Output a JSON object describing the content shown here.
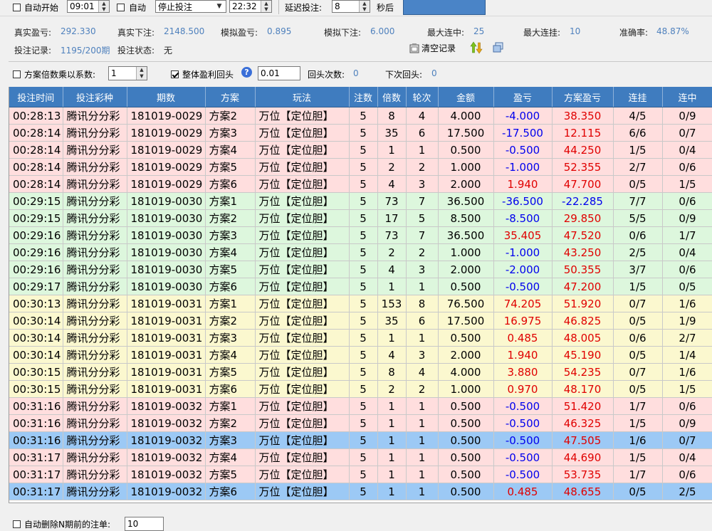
{
  "topbar": {
    "auto_start_label": "自动开始",
    "auto_start_time": "09:01",
    "auto_label": "自动",
    "stop_select": "停止投注",
    "stop_time": "22:32",
    "delay_label": "延迟投注:",
    "delay_value": "8",
    "delay_unit": "秒后"
  },
  "stats": {
    "real_profit_label": "真实盈亏:",
    "real_profit": "292.330",
    "real_bet_label": "真实下注:",
    "real_bet": "2148.500",
    "sim_profit_label": "模拟盈亏:",
    "sim_profit": "0.895",
    "sim_bet_label": "模拟下注:",
    "sim_bet": "6.000",
    "max_streak_hit_label": "最大连中:",
    "max_streak_hit": "25",
    "max_streak_miss_label": "最大连挂:",
    "max_streak_miss": "10",
    "accuracy_label": "准确率:",
    "accuracy": "48.87%",
    "record_label": "投注记录:",
    "record_value": "1195/200期",
    "status_label": "投注状态:",
    "status_value": "无",
    "clear_label": "清空记录"
  },
  "options": {
    "multiplier_label": "方案倍数乘以系数:",
    "multiplier_value": "1",
    "rollback_label": "整体盈利回头",
    "rollback_value": "0.01",
    "rollback_count_label": "回头次数:",
    "rollback_count": "0",
    "next_rollback_label": "下次回头:",
    "next_rollback": "0"
  },
  "table": {
    "headers": [
      "投注时间",
      "投注彩种",
      "期数",
      "方案",
      "玩法",
      "注数",
      "倍数",
      "轮次",
      "金额",
      "盈亏",
      "方案盈亏",
      "连挂",
      "连中"
    ],
    "rows": [
      {
        "time": "00:28:13",
        "lottery": "腾讯分分彩",
        "period": "181019-0029",
        "plan": "方案2",
        "play": "万位【定位胆】",
        "count": "5",
        "mult": "8",
        "round": "4",
        "amount": "4.000",
        "profit": "-4.000",
        "plan_profit": "38.350",
        "miss": "4/5",
        "hit": "0/9",
        "color": "pink",
        "profit_sign": "neg",
        "plan_sign": "pos"
      },
      {
        "time": "00:28:14",
        "lottery": "腾讯分分彩",
        "period": "181019-0029",
        "plan": "方案3",
        "play": "万位【定位胆】",
        "count": "5",
        "mult": "35",
        "round": "6",
        "amount": "17.500",
        "profit": "-17.500",
        "plan_profit": "12.115",
        "miss": "6/6",
        "hit": "0/7",
        "color": "pink",
        "profit_sign": "neg",
        "plan_sign": "pos"
      },
      {
        "time": "00:28:14",
        "lottery": "腾讯分分彩",
        "period": "181019-0029",
        "plan": "方案4",
        "play": "万位【定位胆】",
        "count": "5",
        "mult": "1",
        "round": "1",
        "amount": "0.500",
        "profit": "-0.500",
        "plan_profit": "44.250",
        "miss": "1/5",
        "hit": "0/4",
        "color": "pink",
        "profit_sign": "neg",
        "plan_sign": "pos"
      },
      {
        "time": "00:28:14",
        "lottery": "腾讯分分彩",
        "period": "181019-0029",
        "plan": "方案5",
        "play": "万位【定位胆】",
        "count": "5",
        "mult": "2",
        "round": "2",
        "amount": "1.000",
        "profit": "-1.000",
        "plan_profit": "52.355",
        "miss": "2/7",
        "hit": "0/6",
        "color": "pink",
        "profit_sign": "neg",
        "plan_sign": "pos"
      },
      {
        "time": "00:28:14",
        "lottery": "腾讯分分彩",
        "period": "181019-0029",
        "plan": "方案6",
        "play": "万位【定位胆】",
        "count": "5",
        "mult": "4",
        "round": "3",
        "amount": "2.000",
        "profit": "1.940",
        "plan_profit": "47.700",
        "miss": "0/5",
        "hit": "1/5",
        "color": "pink",
        "profit_sign": "pos",
        "plan_sign": "pos"
      },
      {
        "time": "00:29:15",
        "lottery": "腾讯分分彩",
        "period": "181019-0030",
        "plan": "方案1",
        "play": "万位【定位胆】",
        "count": "5",
        "mult": "73",
        "round": "7",
        "amount": "36.500",
        "profit": "-36.500",
        "plan_profit": "-22.285",
        "miss": "7/7",
        "hit": "0/6",
        "color": "green",
        "profit_sign": "neg",
        "plan_sign": "neg"
      },
      {
        "time": "00:29:15",
        "lottery": "腾讯分分彩",
        "period": "181019-0030",
        "plan": "方案2",
        "play": "万位【定位胆】",
        "count": "5",
        "mult": "17",
        "round": "5",
        "amount": "8.500",
        "profit": "-8.500",
        "plan_profit": "29.850",
        "miss": "5/5",
        "hit": "0/9",
        "color": "green",
        "profit_sign": "neg",
        "plan_sign": "pos"
      },
      {
        "time": "00:29:16",
        "lottery": "腾讯分分彩",
        "period": "181019-0030",
        "plan": "方案3",
        "play": "万位【定位胆】",
        "count": "5",
        "mult": "73",
        "round": "7",
        "amount": "36.500",
        "profit": "35.405",
        "plan_profit": "47.520",
        "miss": "0/6",
        "hit": "1/7",
        "color": "green",
        "profit_sign": "pos",
        "plan_sign": "pos"
      },
      {
        "time": "00:29:16",
        "lottery": "腾讯分分彩",
        "period": "181019-0030",
        "plan": "方案4",
        "play": "万位【定位胆】",
        "count": "5",
        "mult": "2",
        "round": "2",
        "amount": "1.000",
        "profit": "-1.000",
        "plan_profit": "43.250",
        "miss": "2/5",
        "hit": "0/4",
        "color": "green",
        "profit_sign": "neg",
        "plan_sign": "pos"
      },
      {
        "time": "00:29:16",
        "lottery": "腾讯分分彩",
        "period": "181019-0030",
        "plan": "方案5",
        "play": "万位【定位胆】",
        "count": "5",
        "mult": "4",
        "round": "3",
        "amount": "2.000",
        "profit": "-2.000",
        "plan_profit": "50.355",
        "miss": "3/7",
        "hit": "0/6",
        "color": "green",
        "profit_sign": "neg",
        "plan_sign": "pos"
      },
      {
        "time": "00:29:17",
        "lottery": "腾讯分分彩",
        "period": "181019-0030",
        "plan": "方案6",
        "play": "万位【定位胆】",
        "count": "5",
        "mult": "1",
        "round": "1",
        "amount": "0.500",
        "profit": "-0.500",
        "plan_profit": "47.200",
        "miss": "1/5",
        "hit": "0/5",
        "color": "green",
        "profit_sign": "neg",
        "plan_sign": "pos"
      },
      {
        "time": "00:30:13",
        "lottery": "腾讯分分彩",
        "period": "181019-0031",
        "plan": "方案1",
        "play": "万位【定位胆】",
        "count": "5",
        "mult": "153",
        "round": "8",
        "amount": "76.500",
        "profit": "74.205",
        "plan_profit": "51.920",
        "miss": "0/7",
        "hit": "1/6",
        "color": "yellow",
        "profit_sign": "pos",
        "plan_sign": "pos"
      },
      {
        "time": "00:30:14",
        "lottery": "腾讯分分彩",
        "period": "181019-0031",
        "plan": "方案2",
        "play": "万位【定位胆】",
        "count": "5",
        "mult": "35",
        "round": "6",
        "amount": "17.500",
        "profit": "16.975",
        "plan_profit": "46.825",
        "miss": "0/5",
        "hit": "1/9",
        "color": "yellow",
        "profit_sign": "pos",
        "plan_sign": "pos"
      },
      {
        "time": "00:30:14",
        "lottery": "腾讯分分彩",
        "period": "181019-0031",
        "plan": "方案3",
        "play": "万位【定位胆】",
        "count": "5",
        "mult": "1",
        "round": "1",
        "amount": "0.500",
        "profit": "0.485",
        "plan_profit": "48.005",
        "miss": "0/6",
        "hit": "2/7",
        "color": "yellow",
        "profit_sign": "pos",
        "plan_sign": "pos"
      },
      {
        "time": "00:30:14",
        "lottery": "腾讯分分彩",
        "period": "181019-0031",
        "plan": "方案4",
        "play": "万位【定位胆】",
        "count": "5",
        "mult": "4",
        "round": "3",
        "amount": "2.000",
        "profit": "1.940",
        "plan_profit": "45.190",
        "miss": "0/5",
        "hit": "1/4",
        "color": "yellow",
        "profit_sign": "pos",
        "plan_sign": "pos"
      },
      {
        "time": "00:30:15",
        "lottery": "腾讯分分彩",
        "period": "181019-0031",
        "plan": "方案5",
        "play": "万位【定位胆】",
        "count": "5",
        "mult": "8",
        "round": "4",
        "amount": "4.000",
        "profit": "3.880",
        "plan_profit": "54.235",
        "miss": "0/7",
        "hit": "1/6",
        "color": "yellow",
        "profit_sign": "pos",
        "plan_sign": "pos"
      },
      {
        "time": "00:30:15",
        "lottery": "腾讯分分彩",
        "period": "181019-0031",
        "plan": "方案6",
        "play": "万位【定位胆】",
        "count": "5",
        "mult": "2",
        "round": "2",
        "amount": "1.000",
        "profit": "0.970",
        "plan_profit": "48.170",
        "miss": "0/5",
        "hit": "1/5",
        "color": "yellow",
        "profit_sign": "pos",
        "plan_sign": "pos"
      },
      {
        "time": "00:31:16",
        "lottery": "腾讯分分彩",
        "period": "181019-0032",
        "plan": "方案1",
        "play": "万位【定位胆】",
        "count": "5",
        "mult": "1",
        "round": "1",
        "amount": "0.500",
        "profit": "-0.500",
        "plan_profit": "51.420",
        "miss": "1/7",
        "hit": "0/6",
        "color": "pink",
        "profit_sign": "neg",
        "plan_sign": "pos"
      },
      {
        "time": "00:31:16",
        "lottery": "腾讯分分彩",
        "period": "181019-0032",
        "plan": "方案2",
        "play": "万位【定位胆】",
        "count": "5",
        "mult": "1",
        "round": "1",
        "amount": "0.500",
        "profit": "-0.500",
        "plan_profit": "46.325",
        "miss": "1/5",
        "hit": "0/9",
        "color": "pink",
        "profit_sign": "neg",
        "plan_sign": "pos"
      },
      {
        "time": "00:31:16",
        "lottery": "腾讯分分彩",
        "period": "181019-0032",
        "plan": "方案3",
        "play": "万位【定位胆】",
        "count": "5",
        "mult": "1",
        "round": "1",
        "amount": "0.500",
        "profit": "-0.500",
        "plan_profit": "47.505",
        "miss": "1/6",
        "hit": "0/7",
        "color": "sel",
        "profit_sign": "neg",
        "plan_sign": "pos"
      },
      {
        "time": "00:31:17",
        "lottery": "腾讯分分彩",
        "period": "181019-0032",
        "plan": "方案4",
        "play": "万位【定位胆】",
        "count": "5",
        "mult": "1",
        "round": "1",
        "amount": "0.500",
        "profit": "-0.500",
        "plan_profit": "44.690",
        "miss": "1/5",
        "hit": "0/4",
        "color": "pink",
        "profit_sign": "neg",
        "plan_sign": "pos"
      },
      {
        "time": "00:31:17",
        "lottery": "腾讯分分彩",
        "period": "181019-0032",
        "plan": "方案5",
        "play": "万位【定位胆】",
        "count": "5",
        "mult": "1",
        "round": "1",
        "amount": "0.500",
        "profit": "-0.500",
        "plan_profit": "53.735",
        "miss": "1/7",
        "hit": "0/6",
        "color": "pink",
        "profit_sign": "neg",
        "plan_sign": "pos"
      },
      {
        "time": "00:31:17",
        "lottery": "腾讯分分彩",
        "period": "181019-0032",
        "plan": "方案6",
        "play": "万位【定位胆】",
        "count": "5",
        "mult": "1",
        "round": "1",
        "amount": "0.500",
        "profit": "0.485",
        "plan_profit": "48.655",
        "miss": "0/5",
        "hit": "2/5",
        "color": "sel",
        "profit_sign": "pos",
        "plan_sign": "pos"
      }
    ]
  },
  "bottom": {
    "auto_delete_label": "自动删除N期前的注单:",
    "auto_delete_value": "10"
  }
}
